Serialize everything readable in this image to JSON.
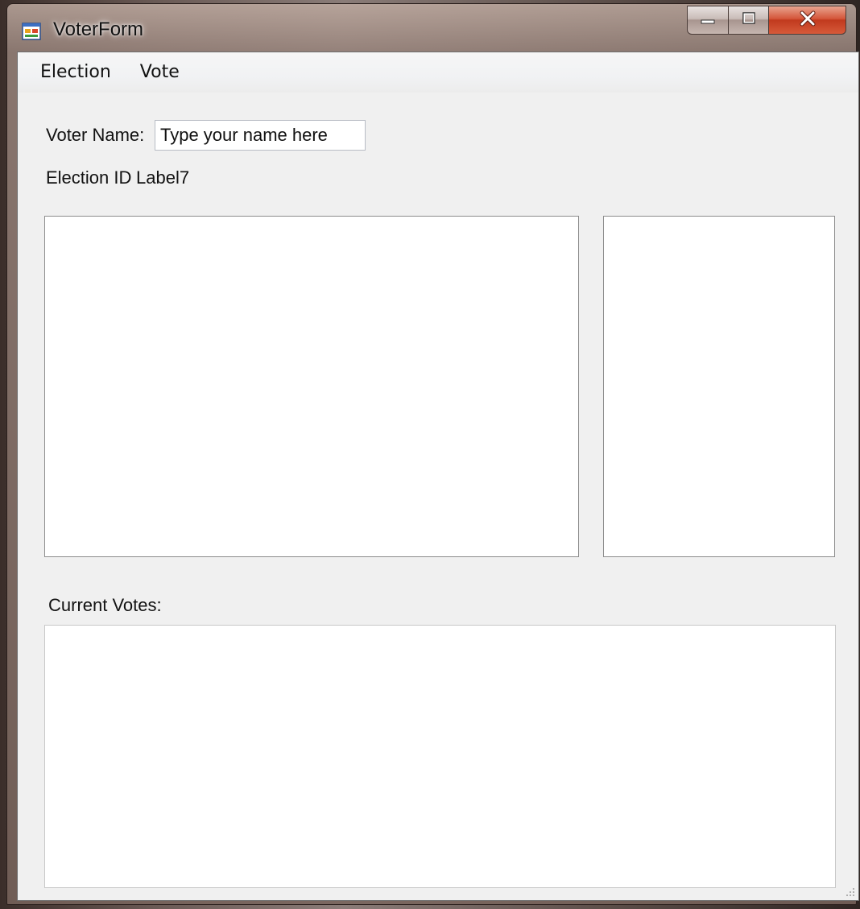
{
  "window": {
    "title": "VoterForm"
  },
  "menu": {
    "items": [
      {
        "label": "Election"
      },
      {
        "label": "Vote"
      }
    ]
  },
  "form": {
    "voter_name_label": "Voter Name:",
    "voter_name_value": "Type your name here",
    "election_id_label": "Election ID",
    "election_id_value": "Label7",
    "current_votes_label": "Current Votes:"
  },
  "colors": {
    "client_bg": "#f0f0f0",
    "close_button": "#c13a1e"
  },
  "icons": [
    "app-icon",
    "minimize-icon",
    "maximize-icon",
    "close-icon",
    "resize-grip-icon"
  ]
}
